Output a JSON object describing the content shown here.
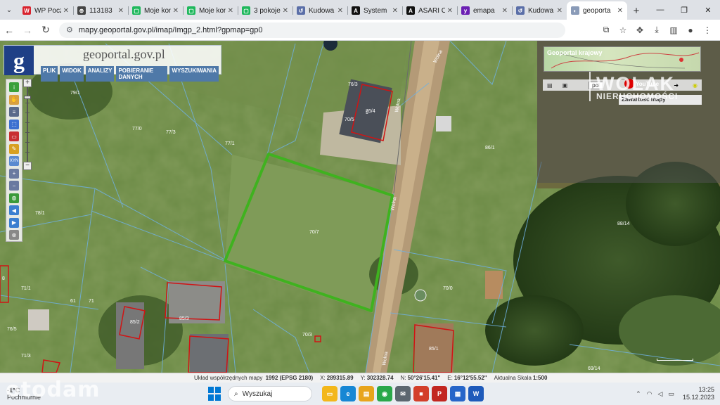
{
  "browser": {
    "tabs": [
      {
        "title": "WP Poczta",
        "favicon_color": "#d9232e",
        "favicon_text": "W"
      },
      {
        "title": "113183",
        "favicon_color": "#444444",
        "favicon_text": "⊕"
      },
      {
        "title": "Moje kon",
        "favicon_color": "#1fb85c",
        "favicon_text": "▢"
      },
      {
        "title": "Moje kon",
        "favicon_color": "#1fb85c",
        "favicon_text": "▢"
      },
      {
        "title": "3 pokoje",
        "favicon_color": "#1fb85c",
        "favicon_text": "▢"
      },
      {
        "title": "Kudowa",
        "favicon_color": "#5b6fa8",
        "favicon_text": "↺"
      },
      {
        "title": "System",
        "favicon_color": "#111111",
        "favicon_text": "A"
      },
      {
        "title": "ASARI C",
        "favicon_color": "#111111",
        "favicon_text": "A"
      },
      {
        "title": "emapa",
        "favicon_color": "#6b1fb3",
        "favicon_text": "y"
      },
      {
        "title": "Kudowa",
        "favicon_color": "#5b6fa8",
        "favicon_text": "↺"
      },
      {
        "title": "geoporta",
        "favicon_color": "#8a9bb8",
        "favicon_text": "◐",
        "active": true
      }
    ],
    "new_tab": "+",
    "window_controls": {
      "minimize": "—",
      "restore": "❐",
      "close": "✕"
    },
    "url": "mapy.geoportal.gov.pl/imap/Imgp_2.html?gpmap=gp0"
  },
  "geoportal": {
    "logo_letter": "g",
    "title": "geoportal.gov.pl",
    "menu": [
      "PLIK",
      "WIDOK",
      "ANALIZY",
      "POBIERANIE DANYCH",
      "WYSZUKIWANIA"
    ],
    "tool_icons": [
      "info-icon",
      "pan-icon",
      "layers-icon",
      "select-icon",
      "measure-icon",
      "draw-icon",
      "coordinates-icon",
      "zoom-in-icon",
      "zoom-out-icon",
      "globe-icon",
      "back-icon",
      "forward-icon",
      "full-extent-icon"
    ],
    "tool_coord_label": "XYN",
    "zoom_plus": "+",
    "zoom_minus": "−"
  },
  "overview": {
    "title": "Geoportal krajowy",
    "language": "pol",
    "youtube": "YouTube",
    "content_panel": "Zawartość mapy"
  },
  "watermark": {
    "brand": "WOLAK",
    "sub": "NIERUCHOMOŚCI",
    "site": "otodam"
  },
  "map": {
    "parcel_labels": [
      {
        "text": "70/7"
      },
      {
        "text": "70/5"
      },
      {
        "text": "77/1"
      },
      {
        "text": "77/0"
      },
      {
        "text": "77/3"
      },
      {
        "text": "78/1"
      },
      {
        "text": "79/1"
      },
      {
        "text": "70/3"
      },
      {
        "text": "70/0"
      },
      {
        "text": "71/1"
      },
      {
        "text": "71"
      },
      {
        "text": "85/1"
      },
      {
        "text": "85/3"
      },
      {
        "text": "85/2"
      },
      {
        "text": "86/1"
      },
      {
        "text": "88/14"
      },
      {
        "text": "69/14"
      },
      {
        "text": "76/3"
      },
      {
        "text": "76/4"
      },
      {
        "text": "76/5"
      },
      {
        "text": "71/3"
      },
      {
        "text": "5"
      },
      {
        "text": "8"
      },
      {
        "text": "61"
      }
    ],
    "road_labels": [
      "Wolna",
      "Wolna",
      "Wolna",
      "Wolna"
    ]
  },
  "statusbar": {
    "crs_label": "Układ współrzędnych mapy",
    "crs_value": "1992 (EPSG 2180)",
    "x_label": "X:",
    "x_value": "289315.89",
    "y_label": "Y:",
    "y_value": "302328.74",
    "n_label": "N:",
    "n_value": "50°26'15.41\"",
    "e_label": "E:",
    "e_value": "16°12'55.52\"",
    "scale_label": "Aktualna Skala",
    "scale_value": "1:500"
  },
  "taskbar": {
    "weather_temp": "-1°C",
    "weather_desc": "Pochmurnie",
    "search_placeholder": "Wyszukaj",
    "apps": [
      {
        "name": "explorer",
        "color": "#f3b71a",
        "glyph": "▭"
      },
      {
        "name": "edge",
        "color": "#1787d4",
        "glyph": "e"
      },
      {
        "name": "files",
        "color": "#e8a51c",
        "glyph": "▤"
      },
      {
        "name": "chrome",
        "color": "#2aa84a",
        "glyph": "◉"
      },
      {
        "name": "mail",
        "color": "#5c6770",
        "glyph": "✉"
      },
      {
        "name": "store",
        "color": "#d33f2a",
        "glyph": "■"
      },
      {
        "name": "pdf",
        "color": "#c2261f",
        "glyph": "P"
      },
      {
        "name": "calendar",
        "color": "#2766c9",
        "glyph": "▦"
      },
      {
        "name": "word",
        "color": "#1e5aba",
        "glyph": "W"
      }
    ],
    "time": "13:25",
    "date": "15.12.2023"
  }
}
